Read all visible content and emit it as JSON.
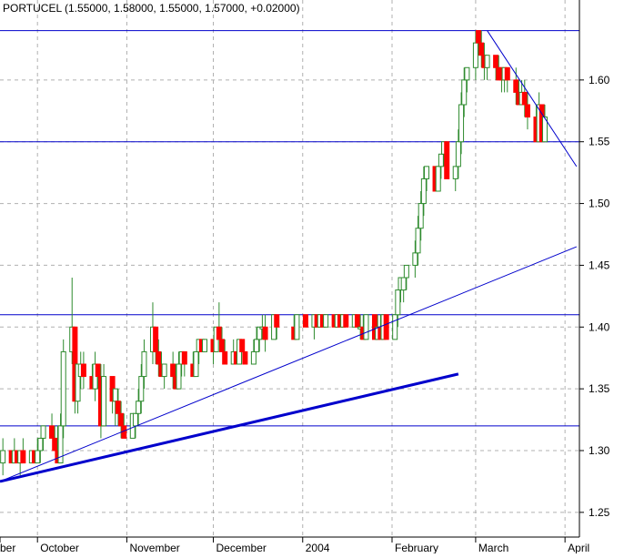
{
  "header": {
    "title": "PORTUCEL (1.55000, 1.58000, 1.55000, 1.57000, +0.02000)"
  },
  "colors": {
    "up": "#2e8b2e",
    "down": "#ff0000",
    "line": "#0000cc",
    "grid": "#b0b0b0"
  },
  "chart_data": {
    "type": "candlestick",
    "title": "PORTUCEL (1.55000, 1.58000, 1.55000, 1.57000, +0.02000)",
    "x_tick_labels": [
      "ber",
      "October",
      "November",
      "December",
      "2004",
      "February",
      "March",
      "April"
    ],
    "y_tick_labels": [
      "1.25",
      "1.30",
      "1.35",
      "1.40",
      "1.45",
      "1.50",
      "1.55",
      "1.60"
    ],
    "y_ticks": [
      1.25,
      1.3,
      1.35,
      1.4,
      1.45,
      1.5,
      1.55,
      1.6
    ],
    "ylim": [
      1.23,
      1.65
    ],
    "grid": true,
    "horizontal_lines": [
      1.64,
      1.55,
      1.41,
      1.32
    ],
    "trend_lines": [
      {
        "from": [
          "Sep 18",
          1.275
        ],
        "to": [
          "Apr 05",
          1.465
        ],
        "weight": "thin"
      },
      {
        "from": [
          "Sep 18",
          1.275
        ],
        "to": [
          "Feb 24",
          1.362
        ],
        "weight": "thick"
      },
      {
        "from": [
          "Mar 05",
          1.64
        ],
        "to": [
          "Apr 05",
          1.53
        ],
        "weight": "thin"
      }
    ],
    "bars": [
      {
        "date": "Sep 19",
        "open": 1.29,
        "high": 1.31,
        "low": 1.28,
        "close": 1.3
      },
      {
        "date": "Sep 22",
        "open": 1.3,
        "high": 1.3,
        "low": 1.29,
        "close": 1.29
      },
      {
        "date": "Sep 23",
        "open": 1.29,
        "high": 1.31,
        "low": 1.29,
        "close": 1.3
      },
      {
        "date": "Sep 24",
        "open": 1.3,
        "high": 1.3,
        "low": 1.29,
        "close": 1.29
      },
      {
        "date": "Sep 25",
        "open": 1.29,
        "high": 1.3,
        "low": 1.28,
        "close": 1.3
      },
      {
        "date": "Sep 26",
        "open": 1.3,
        "high": 1.31,
        "low": 1.29,
        "close": 1.29
      },
      {
        "date": "Sep 29",
        "open": 1.29,
        "high": 1.3,
        "low": 1.29,
        "close": 1.3
      },
      {
        "date": "Sep 30",
        "open": 1.3,
        "high": 1.3,
        "low": 1.29,
        "close": 1.29
      },
      {
        "date": "Oct 01",
        "open": 1.29,
        "high": 1.31,
        "low": 1.29,
        "close": 1.3
      },
      {
        "date": "Oct 02",
        "open": 1.3,
        "high": 1.31,
        "low": 1.29,
        "close": 1.31
      },
      {
        "date": "Oct 03",
        "open": 1.31,
        "high": 1.32,
        "low": 1.3,
        "close": 1.32
      },
      {
        "date": "Oct 06",
        "open": 1.32,
        "high": 1.33,
        "low": 1.31,
        "close": 1.31
      },
      {
        "date": "Oct 07",
        "open": 1.31,
        "high": 1.32,
        "low": 1.3,
        "close": 1.3
      },
      {
        "date": "Oct 08",
        "open": 1.3,
        "high": 1.32,
        "low": 1.29,
        "close": 1.29
      },
      {
        "date": "Oct 09",
        "open": 1.29,
        "high": 1.33,
        "low": 1.29,
        "close": 1.32
      },
      {
        "date": "Oct 10",
        "open": 1.32,
        "high": 1.39,
        "low": 1.31,
        "close": 1.38
      },
      {
        "date": "Oct 13",
        "open": 1.38,
        "high": 1.44,
        "low": 1.37,
        "close": 1.4
      },
      {
        "date": "Oct 14",
        "open": 1.4,
        "high": 1.4,
        "low": 1.33,
        "close": 1.34
      },
      {
        "date": "Oct 15",
        "open": 1.34,
        "high": 1.37,
        "low": 1.33,
        "close": 1.37
      },
      {
        "date": "Oct 16",
        "open": 1.36,
        "high": 1.38,
        "low": 1.35,
        "close": 1.37
      },
      {
        "date": "Oct 17",
        "open": 1.37,
        "high": 1.38,
        "low": 1.35,
        "close": 1.36
      },
      {
        "date": "Oct 20",
        "open": 1.36,
        "high": 1.37,
        "low": 1.35,
        "close": 1.35
      },
      {
        "date": "Oct 21",
        "open": 1.35,
        "high": 1.38,
        "low": 1.34,
        "close": 1.37
      },
      {
        "date": "Oct 22",
        "open": 1.37,
        "high": 1.37,
        "low": 1.35,
        "close": 1.36
      },
      {
        "date": "Oct 23",
        "open": 1.36,
        "high": 1.37,
        "low": 1.31,
        "close": 1.32
      },
      {
        "date": "Oct 24",
        "open": 1.32,
        "high": 1.37,
        "low": 1.32,
        "close": 1.36
      },
      {
        "date": "Oct 27",
        "open": 1.36,
        "high": 1.36,
        "low": 1.33,
        "close": 1.34
      },
      {
        "date": "Oct 28",
        "open": 1.34,
        "high": 1.35,
        "low": 1.32,
        "close": 1.35
      },
      {
        "date": "Oct 29",
        "open": 1.34,
        "high": 1.35,
        "low": 1.32,
        "close": 1.33
      },
      {
        "date": "Oct 30",
        "open": 1.33,
        "high": 1.34,
        "low": 1.31,
        "close": 1.32
      },
      {
        "date": "Oct 31",
        "open": 1.32,
        "high": 1.33,
        "low": 1.31,
        "close": 1.31
      },
      {
        "date": "Nov 03",
        "open": 1.31,
        "high": 1.33,
        "low": 1.31,
        "close": 1.33
      },
      {
        "date": "Nov 04",
        "open": 1.32,
        "high": 1.33,
        "low": 1.31,
        "close": 1.33
      },
      {
        "date": "Nov 05",
        "open": 1.33,
        "high": 1.35,
        "low": 1.32,
        "close": 1.34
      },
      {
        "date": "Nov 06",
        "open": 1.34,
        "high": 1.37,
        "low": 1.33,
        "close": 1.36
      },
      {
        "date": "Nov 07",
        "open": 1.36,
        "high": 1.39,
        "low": 1.35,
        "close": 1.38
      },
      {
        "date": "Nov 10",
        "open": 1.38,
        "high": 1.42,
        "low": 1.37,
        "close": 1.4
      },
      {
        "date": "Nov 11",
        "open": 1.4,
        "high": 1.4,
        "low": 1.37,
        "close": 1.38
      },
      {
        "date": "Nov 12",
        "open": 1.38,
        "high": 1.39,
        "low": 1.36,
        "close": 1.37
      },
      {
        "date": "Nov 13",
        "open": 1.37,
        "high": 1.38,
        "low": 1.36,
        "close": 1.36
      },
      {
        "date": "Nov 14",
        "open": 1.36,
        "high": 1.37,
        "low": 1.35,
        "close": 1.37
      },
      {
        "date": "Nov 17",
        "open": 1.37,
        "high": 1.38,
        "low": 1.35,
        "close": 1.36
      },
      {
        "date": "Nov 18",
        "open": 1.36,
        "high": 1.37,
        "low": 1.35,
        "close": 1.35
      },
      {
        "date": "Nov 19",
        "open": 1.35,
        "high": 1.38,
        "low": 1.35,
        "close": 1.37
      },
      {
        "date": "Nov 20",
        "open": 1.37,
        "high": 1.38,
        "low": 1.36,
        "close": 1.38
      },
      {
        "date": "Nov 21",
        "open": 1.38,
        "high": 1.38,
        "low": 1.36,
        "close": 1.37
      },
      {
        "date": "Nov 24",
        "open": 1.37,
        "high": 1.38,
        "low": 1.36,
        "close": 1.36
      },
      {
        "date": "Nov 25",
        "open": 1.36,
        "high": 1.38,
        "low": 1.36,
        "close": 1.38
      },
      {
        "date": "Nov 26",
        "open": 1.38,
        "high": 1.39,
        "low": 1.37,
        "close": 1.39
      },
      {
        "date": "Nov 27",
        "open": 1.39,
        "high": 1.39,
        "low": 1.38,
        "close": 1.38
      },
      {
        "date": "Nov 28",
        "open": 1.38,
        "high": 1.39,
        "low": 1.38,
        "close": 1.39
      },
      {
        "date": "Dec 01",
        "open": 1.39,
        "high": 1.39,
        "low": 1.37,
        "close": 1.38
      },
      {
        "date": "Dec 02",
        "open": 1.38,
        "high": 1.4,
        "low": 1.38,
        "close": 1.4
      },
      {
        "date": "Dec 03",
        "open": 1.4,
        "high": 1.42,
        "low": 1.39,
        "close": 1.39
      },
      {
        "date": "Dec 04",
        "open": 1.39,
        "high": 1.4,
        "low": 1.38,
        "close": 1.38
      },
      {
        "date": "Dec 05",
        "open": 1.38,
        "high": 1.39,
        "low": 1.37,
        "close": 1.37
      },
      {
        "date": "Dec 08",
        "open": 1.37,
        "high": 1.39,
        "low": 1.37,
        "close": 1.38
      },
      {
        "date": "Dec 09",
        "open": 1.38,
        "high": 1.38,
        "low": 1.37,
        "close": 1.37
      },
      {
        "date": "Dec 10",
        "open": 1.37,
        "high": 1.39,
        "low": 1.37,
        "close": 1.39
      },
      {
        "date": "Dec 11",
        "open": 1.39,
        "high": 1.39,
        "low": 1.38,
        "close": 1.38
      },
      {
        "date": "Dec 12",
        "open": 1.38,
        "high": 1.38,
        "low": 1.37,
        "close": 1.37
      },
      {
        "date": "Dec 15",
        "open": 1.37,
        "high": 1.39,
        "low": 1.37,
        "close": 1.38
      },
      {
        "date": "Dec 16",
        "open": 1.38,
        "high": 1.4,
        "low": 1.38,
        "close": 1.39
      },
      {
        "date": "Dec 17",
        "open": 1.39,
        "high": 1.4,
        "low": 1.38,
        "close": 1.4
      },
      {
        "date": "Dec 18",
        "open": 1.4,
        "high": 1.41,
        "low": 1.39,
        "close": 1.4
      },
      {
        "date": "Dec 19",
        "open": 1.4,
        "high": 1.41,
        "low": 1.38,
        "close": 1.39
      },
      {
        "date": "Dec 22",
        "open": 1.39,
        "high": 1.41,
        "low": 1.39,
        "close": 1.41
      },
      {
        "date": "Dec 23",
        "open": 1.41,
        "high": 1.41,
        "low": 1.39,
        "close": 1.4
      },
      {
        "date": "Dec 29",
        "open": 1.4,
        "high": 1.41,
        "low": 1.39,
        "close": 1.39
      },
      {
        "date": "Dec 30",
        "open": 1.39,
        "high": 1.41,
        "low": 1.39,
        "close": 1.41
      },
      {
        "date": "Jan 02",
        "open": 1.41,
        "high": 1.41,
        "low": 1.4,
        "close": 1.4
      },
      {
        "date": "Jan 05",
        "open": 1.4,
        "high": 1.41,
        "low": 1.39,
        "close": 1.41
      },
      {
        "date": "Jan 06",
        "open": 1.41,
        "high": 1.41,
        "low": 1.4,
        "close": 1.4
      },
      {
        "date": "Jan 07",
        "open": 1.4,
        "high": 1.41,
        "low": 1.4,
        "close": 1.41
      },
      {
        "date": "Jan 08",
        "open": 1.41,
        "high": 1.41,
        "low": 1.4,
        "close": 1.4
      },
      {
        "date": "Jan 09",
        "open": 1.4,
        "high": 1.41,
        "low": 1.4,
        "close": 1.41
      },
      {
        "date": "Jan 12",
        "open": 1.41,
        "high": 1.41,
        "low": 1.4,
        "close": 1.4
      },
      {
        "date": "Jan 13",
        "open": 1.4,
        "high": 1.41,
        "low": 1.4,
        "close": 1.41
      },
      {
        "date": "Jan 14",
        "open": 1.41,
        "high": 1.41,
        "low": 1.4,
        "close": 1.4
      },
      {
        "date": "Jan 15",
        "open": 1.4,
        "high": 1.41,
        "low": 1.4,
        "close": 1.41
      },
      {
        "date": "Jan 16",
        "open": 1.41,
        "high": 1.41,
        "low": 1.4,
        "close": 1.4
      },
      {
        "date": "Jan 19",
        "open": 1.4,
        "high": 1.41,
        "low": 1.4,
        "close": 1.41
      },
      {
        "date": "Jan 20",
        "open": 1.41,
        "high": 1.41,
        "low": 1.4,
        "close": 1.4
      },
      {
        "date": "Jan 21",
        "open": 1.4,
        "high": 1.41,
        "low": 1.39,
        "close": 1.4
      },
      {
        "date": "Jan 22",
        "open": 1.4,
        "high": 1.41,
        "low": 1.39,
        "close": 1.39
      },
      {
        "date": "Jan 23",
        "open": 1.39,
        "high": 1.41,
        "low": 1.39,
        "close": 1.41
      },
      {
        "date": "Jan 26",
        "open": 1.41,
        "high": 1.41,
        "low": 1.39,
        "close": 1.39
      },
      {
        "date": "Jan 27",
        "open": 1.39,
        "high": 1.41,
        "low": 1.39,
        "close": 1.4
      },
      {
        "date": "Jan 28",
        "open": 1.4,
        "high": 1.41,
        "low": 1.39,
        "close": 1.39
      },
      {
        "date": "Jan 29",
        "open": 1.39,
        "high": 1.41,
        "low": 1.39,
        "close": 1.41
      },
      {
        "date": "Jan 30",
        "open": 1.41,
        "high": 1.41,
        "low": 1.39,
        "close": 1.39
      },
      {
        "date": "Feb 02",
        "open": 1.39,
        "high": 1.41,
        "low": 1.39,
        "close": 1.41
      },
      {
        "date": "Feb 03",
        "open": 1.41,
        "high": 1.43,
        "low": 1.4,
        "close": 1.43
      },
      {
        "date": "Feb 04",
        "open": 1.43,
        "high": 1.44,
        "low": 1.42,
        "close": 1.44
      },
      {
        "date": "Feb 05",
        "open": 1.43,
        "high": 1.44,
        "low": 1.42,
        "close": 1.44
      },
      {
        "date": "Feb 06",
        "open": 1.44,
        "high": 1.45,
        "low": 1.43,
        "close": 1.45
      },
      {
        "date": "Feb 09",
        "open": 1.45,
        "high": 1.47,
        "low": 1.44,
        "close": 1.46
      },
      {
        "date": "Feb 10",
        "open": 1.46,
        "high": 1.49,
        "low": 1.45,
        "close": 1.48
      },
      {
        "date": "Feb 11",
        "open": 1.48,
        "high": 1.51,
        "low": 1.47,
        "close": 1.5
      },
      {
        "date": "Feb 12",
        "open": 1.5,
        "high": 1.53,
        "low": 1.49,
        "close": 1.52
      },
      {
        "date": "Feb 13",
        "open": 1.52,
        "high": 1.53,
        "low": 1.51,
        "close": 1.53
      },
      {
        "date": "Feb 16",
        "open": 1.53,
        "high": 1.53,
        "low": 1.51,
        "close": 1.51
      },
      {
        "date": "Feb 17",
        "open": 1.51,
        "high": 1.53,
        "low": 1.51,
        "close": 1.53
      },
      {
        "date": "Feb 18",
        "open": 1.53,
        "high": 1.54,
        "low": 1.52,
        "close": 1.54
      },
      {
        "date": "Feb 19",
        "open": 1.54,
        "high": 1.55,
        "low": 1.53,
        "close": 1.55
      },
      {
        "date": "Feb 20",
        "open": 1.55,
        "high": 1.55,
        "low": 1.52,
        "close": 1.52
      },
      {
        "date": "Feb 23",
        "open": 1.52,
        "high": 1.53,
        "low": 1.51,
        "close": 1.53
      },
      {
        "date": "Feb 24",
        "open": 1.53,
        "high": 1.56,
        "low": 1.52,
        "close": 1.55
      },
      {
        "date": "Feb 25",
        "open": 1.55,
        "high": 1.59,
        "low": 1.54,
        "close": 1.58
      },
      {
        "date": "Feb 26",
        "open": 1.58,
        "high": 1.61,
        "low": 1.57,
        "close": 1.6
      },
      {
        "date": "Feb 27",
        "open": 1.6,
        "high": 1.61,
        "low": 1.59,
        "close": 1.61
      },
      {
        "date": "Mar 01",
        "open": 1.61,
        "high": 1.64,
        "low": 1.6,
        "close": 1.63
      },
      {
        "date": "Mar 02",
        "open": 1.64,
        "high": 1.64,
        "low": 1.62,
        "close": 1.63
      },
      {
        "date": "Mar 03",
        "open": 1.63,
        "high": 1.64,
        "low": 1.61,
        "close": 1.62
      },
      {
        "date": "Mar 04",
        "open": 1.62,
        "high": 1.63,
        "low": 1.6,
        "close": 1.61
      },
      {
        "date": "Mar 05",
        "open": 1.61,
        "high": 1.62,
        "low": 1.6,
        "close": 1.62
      },
      {
        "date": "Mar 08",
        "open": 1.62,
        "high": 1.62,
        "low": 1.6,
        "close": 1.61
      },
      {
        "date": "Mar 09",
        "open": 1.61,
        "high": 1.62,
        "low": 1.6,
        "close": 1.6
      },
      {
        "date": "Mar 10",
        "open": 1.61,
        "high": 1.61,
        "low": 1.59,
        "close": 1.6
      },
      {
        "date": "Mar 11",
        "open": 1.6,
        "high": 1.61,
        "low": 1.59,
        "close": 1.61
      },
      {
        "date": "Mar 12",
        "open": 1.61,
        "high": 1.61,
        "low": 1.59,
        "close": 1.6
      },
      {
        "date": "Mar 15",
        "open": 1.6,
        "high": 1.61,
        "low": 1.58,
        "close": 1.59
      },
      {
        "date": "Mar 16",
        "open": 1.59,
        "high": 1.6,
        "low": 1.58,
        "close": 1.58
      },
      {
        "date": "Mar 17",
        "open": 1.58,
        "high": 1.6,
        "low": 1.58,
        "close": 1.59
      },
      {
        "date": "Mar 18",
        "open": 1.59,
        "high": 1.6,
        "low": 1.57,
        "close": 1.58
      },
      {
        "date": "Mar 19",
        "open": 1.58,
        "high": 1.59,
        "low": 1.56,
        "close": 1.57
      },
      {
        "date": "Mar 22",
        "open": 1.57,
        "high": 1.58,
        "low": 1.55,
        "close": 1.55
      },
      {
        "date": "Mar 23",
        "open": 1.55,
        "high": 1.59,
        "low": 1.55,
        "close": 1.58
      },
      {
        "date": "Mar 24",
        "open": 1.58,
        "high": 1.58,
        "low": 1.55,
        "close": 1.55
      },
      {
        "date": "Mar 25",
        "open": 1.55,
        "high": 1.58,
        "low": 1.55,
        "close": 1.57
      }
    ]
  }
}
